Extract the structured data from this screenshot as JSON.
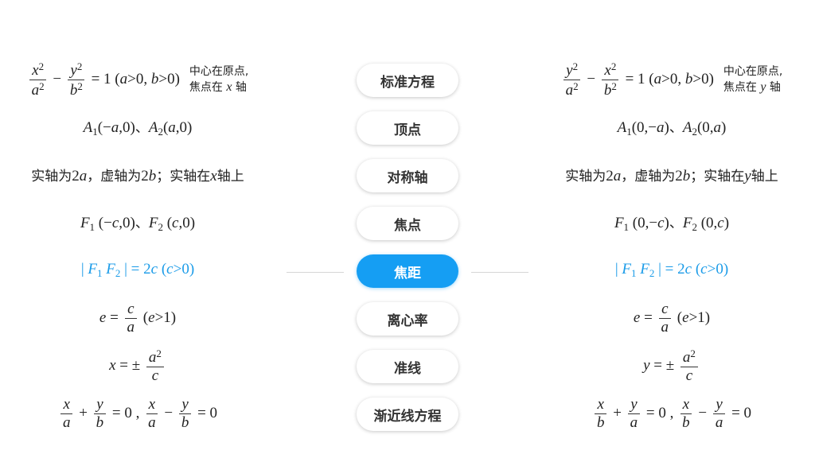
{
  "buttons": [
    {
      "label": "标准方程"
    },
    {
      "label": "顶点"
    },
    {
      "label": "对称轴"
    },
    {
      "label": "焦点"
    },
    {
      "label": "焦距"
    },
    {
      "label": "离心率"
    },
    {
      "label": "准线"
    },
    {
      "label": "渐近线方程"
    }
  ],
  "active_index": 4,
  "accent_color": "#159ef3",
  "left": {
    "note1": "中心在原点,",
    "note2_prefix": "焦点在",
    "note2_var": "x",
    "note2_suffix": "轴",
    "vertex": "A₁(−a,0)、A₂(a,0)",
    "axis_text": "实轴为2a，虚轴为2b；实轴在x轴上",
    "foci": "F₁ (−c,0)、F₂ (c,0)",
    "focal_distance": "| F₁ F₂ | = 2c (c>0)",
    "directrix_var": "x"
  },
  "right": {
    "note1": "中心在原点,",
    "note2_prefix": "焦点在",
    "note2_var": "y",
    "note2_suffix": "轴",
    "vertex": "A₁(0,−a)、A₂(0,a)",
    "axis_text": "实轴为2a，虚轴为2b；实轴在y轴上",
    "foci": "F₁ (0,−c)、F₂ (0,c)",
    "focal_distance": "| F₁ F₂ | = 2c (c>0)",
    "directrix_var": "y"
  }
}
